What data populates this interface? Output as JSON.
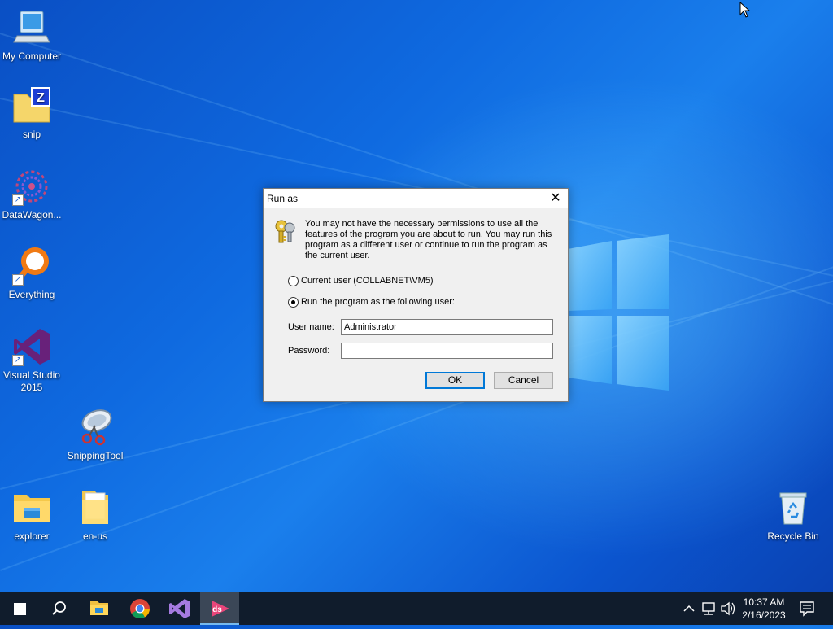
{
  "desktop": {
    "icons": [
      {
        "label": "My Computer",
        "icon": "computer-icon"
      },
      {
        "label": "snip",
        "icon": "folder-zip-icon"
      },
      {
        "label": "DataWagon...",
        "icon": "datawagon-icon"
      },
      {
        "label": "Everything",
        "icon": "everything-search-icon"
      },
      {
        "label": "Visual Studio 2015",
        "icon": "visual-studio-icon"
      },
      {
        "label": "SnippingTool",
        "icon": "snipping-tool-icon"
      },
      {
        "label": "explorer",
        "icon": "explorer-folder-icon"
      },
      {
        "label": "en-us",
        "icon": "document-folder-icon"
      },
      {
        "label": "Recycle Bin",
        "icon": "recycle-bin-icon"
      }
    ]
  },
  "dialog": {
    "title": "Run as",
    "close_glyph": "✕",
    "message": "You may not have the necessary permissions to use all the features of the program you are about to run. You may run this program as a different user or continue to run the program as the current user.",
    "option_current": "Current user (COLLABNET\\VM5)",
    "option_other": "Run the program as the following user:",
    "selected_option": "other",
    "username_label": "User name:",
    "username_value": "Administrator",
    "password_label": "Password:",
    "password_value": "",
    "ok_label": "OK",
    "cancel_label": "Cancel"
  },
  "taskbar": {
    "items": [
      "start-icon",
      "search-icon",
      "file-explorer-icon",
      "chrome-icon",
      "visual-studio-icon",
      "datastation-icon"
    ],
    "active_item": "datastation-icon",
    "clock_time": "10:37 AM",
    "clock_date": "2/16/2023"
  },
  "colors": {
    "desktop_blue": "#0f6ae0",
    "taskbar": "#101c2c",
    "accent": "#0078d7"
  }
}
